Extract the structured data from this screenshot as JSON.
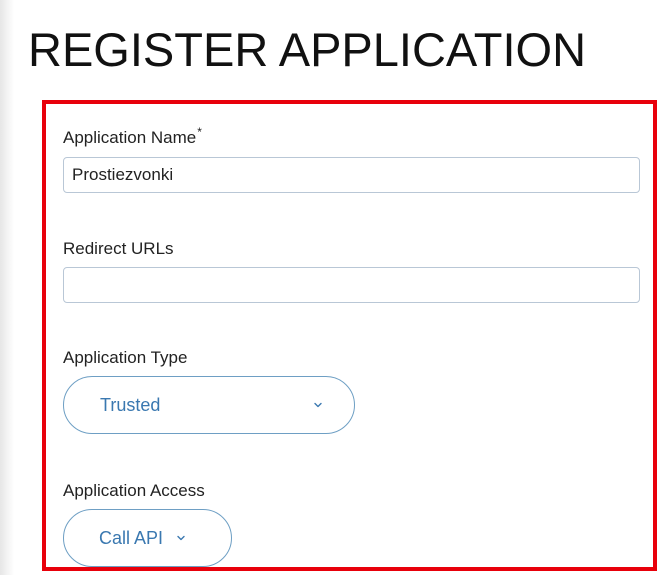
{
  "page": {
    "title": "REGISTER APPLICATION"
  },
  "form": {
    "app_name": {
      "label": "Application Name",
      "required_marker": "*",
      "value": "Prostiezvonki"
    },
    "redirect_urls": {
      "label": "Redirect URLs",
      "value": ""
    },
    "app_type": {
      "label": "Application Type",
      "selected": "Trusted"
    },
    "app_access": {
      "label": "Application Access",
      "selected": "Call API"
    }
  },
  "colors": {
    "highlight_border": "#e8000b",
    "dropdown_text": "#3a78b0",
    "dropdown_border": "#6e9fc4",
    "input_border": "#b9c7d6"
  },
  "icons": {
    "dropdown": "chevron-down-icon"
  }
}
